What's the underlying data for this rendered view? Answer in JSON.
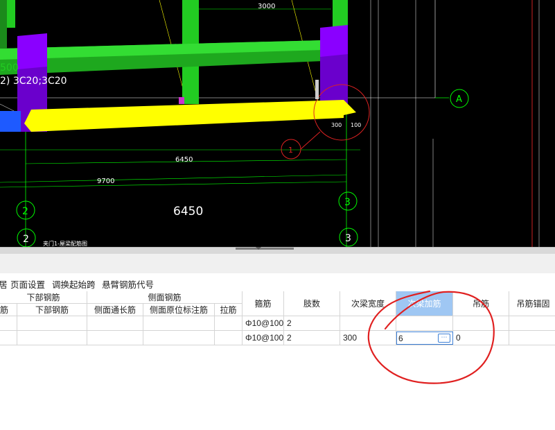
{
  "cad": {
    "labels": {
      "dim_top": "3000",
      "dim_500": "500",
      "rebar_note": "2) 3C20;3C20",
      "dim_6450_small": "6450",
      "dim_9700": "9700",
      "dim_6450_big": "6450",
      "dim_300": "300",
      "dim_100": "100",
      "axis_a": "A",
      "axis_1": "1",
      "axis_2_top": "2",
      "axis_3_top": "3",
      "axis_2_bottom": "2",
      "axis_3_bottom": "3",
      "drawing_note": "夹门1-屋梁配筋图"
    },
    "colors": {
      "beam_green": "#22cc22",
      "column_purple": "#8a00ff",
      "beam_yellow": "#ffff00",
      "axis_green": "#00ff00"
    }
  },
  "menu": [
    "居",
    "页面设置",
    "调换起始跨",
    "悬臂钢筋代号"
  ],
  "table": {
    "group_headers": [
      "下部钢筋",
      "侧面钢筋"
    ],
    "headers": [
      "筋",
      "下部钢筋",
      "侧面通长筋",
      "侧面原位标注筋",
      "拉筋",
      "箍筋",
      "肢数",
      "次梁宽度",
      "次梁加筋",
      "吊筋",
      "吊筋锚固"
    ],
    "selected_header": "次梁加筋",
    "rows": [
      [
        "",
        "",
        "",
        "",
        "",
        "Φ10@100",
        "2",
        "",
        "",
        "",
        ""
      ],
      [
        "",
        "",
        "",
        "",
        "",
        "Φ10@100",
        "2",
        "300",
        "",
        "0",
        ""
      ]
    ],
    "edit_value": "6",
    "edit_button": "⋯"
  }
}
